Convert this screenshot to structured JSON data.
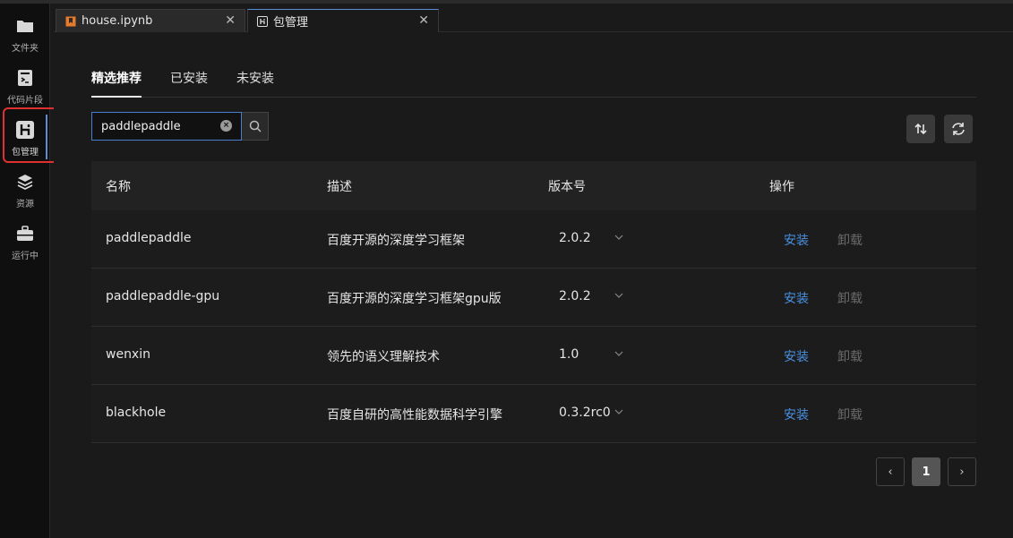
{
  "sidebar": {
    "items": [
      {
        "label": "文件夹",
        "icon": "folder-icon"
      },
      {
        "label": "代码片段",
        "icon": "snippet-icon"
      },
      {
        "label": "包管理",
        "icon": "package-icon"
      },
      {
        "label": "资源",
        "icon": "layers-icon"
      },
      {
        "label": "运行中",
        "icon": "briefcase-icon"
      }
    ]
  },
  "tabs": [
    {
      "label": "house.ipynb",
      "close": "✕"
    },
    {
      "label": "包管理",
      "close": "✕"
    }
  ],
  "subtabs": [
    "精选推荐",
    "已安装",
    "未安装"
  ],
  "search": {
    "value": "paddlepaddle",
    "placeholder": ""
  },
  "table": {
    "headers": {
      "name": "名称",
      "desc": "描述",
      "version": "版本号",
      "action": "操作"
    },
    "rows": [
      {
        "name": "paddlepaddle",
        "desc": "百度开源的深度学习框架",
        "version": "2.0.2",
        "install": "安装",
        "uninstall": "卸载"
      },
      {
        "name": "paddlepaddle-gpu",
        "desc": "百度开源的深度学习框架gpu版",
        "version": "2.0.2",
        "install": "安装",
        "uninstall": "卸载"
      },
      {
        "name": "wenxin",
        "desc": "领先的语义理解技术",
        "version": "1.0",
        "install": "安装",
        "uninstall": "卸载"
      },
      {
        "name": "blackhole",
        "desc": "百度自研的高性能数据科学引擎",
        "version": "0.3.2rc0",
        "install": "安装",
        "uninstall": "卸载"
      }
    ]
  },
  "pagination": {
    "prev": "‹",
    "current": "1",
    "next": "›"
  },
  "colors": {
    "accent": "#4a90e2",
    "highlight": "#e03030"
  }
}
